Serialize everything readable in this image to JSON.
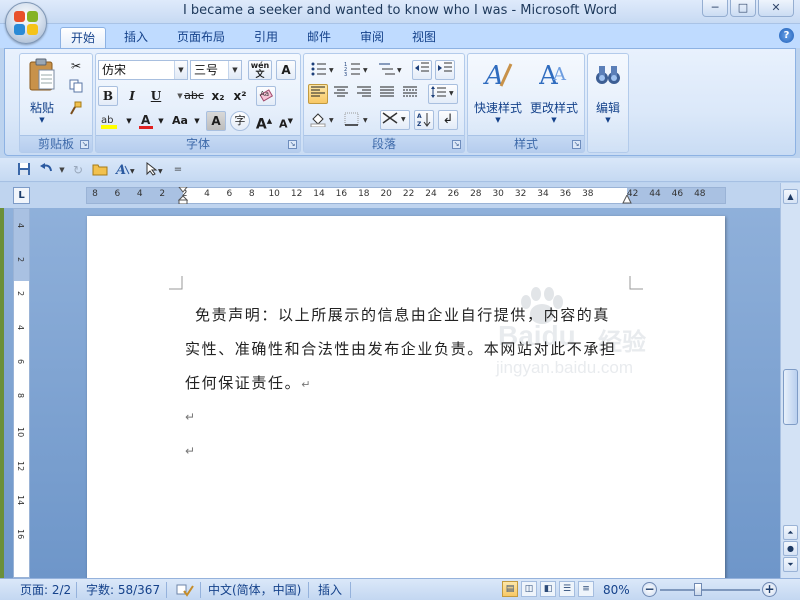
{
  "window": {
    "title": "I became a seeker and wanted to know who I was - Microsoft Word",
    "buttons": {
      "minimize": "─",
      "restore": "□",
      "close": "✕"
    }
  },
  "tabs": [
    "开始",
    "插入",
    "页面布局",
    "引用",
    "邮件",
    "审阅",
    "视图"
  ],
  "active_tab": "开始",
  "help": "?",
  "ribbon": {
    "clipboard": {
      "label": "剪贴板",
      "paste": "粘贴"
    },
    "font": {
      "label": "字体",
      "font_name": "仿宋",
      "font_size": "三号",
      "wen_label": "wén",
      "a_box": "A",
      "bold": "B",
      "italic": "I",
      "underline": "U",
      "strike": "abc",
      "subscript": "x₂",
      "superscript": "x²",
      "grow": "A",
      "shrink": "A",
      "change_case": "Aa",
      "char_shading": "A",
      "enclose": "字"
    },
    "paragraph": {
      "label": "段落"
    },
    "styles": {
      "label": "样式",
      "quick_styles": "快速样式",
      "change_styles": "更改样式"
    },
    "editing": {
      "label": "编辑",
      "editing_button": "编辑"
    }
  },
  "ruler": {
    "corner": "L",
    "ticks": [
      "8",
      "6",
      "4",
      "2",
      "2",
      "4",
      "6",
      "8",
      "10",
      "12",
      "14",
      "16",
      "18",
      "20",
      "22",
      "24",
      "26",
      "28",
      "30",
      "32",
      "34",
      "36",
      "38",
      "42",
      "44",
      "46",
      "48"
    ],
    "vticks": [
      "4",
      "2",
      "2",
      "4",
      "6",
      "8",
      "10",
      "12",
      "14",
      "16"
    ]
  },
  "document": {
    "paragraphs": [
      "免责声明：以上所展示的信息由企业自行提供，内容的真",
      "实性、准确性和合法性由发布企业负责。本网站对此不承担",
      "任何保证责任。"
    ],
    "watermark": {
      "logo": "Baidu",
      "cn": "经验",
      "url": "jingyan.baidu.com"
    }
  },
  "status": {
    "page": "页面: 2/2",
    "words": "字数: 58/367",
    "language": "中文(简体，中国)",
    "mode": "插入",
    "zoom": "80%"
  },
  "colors": {
    "accent": "#15428b",
    "ribbon_bg": "#dbe8f9",
    "page_bg": "#ffffff",
    "highlight": "#f8c865"
  }
}
